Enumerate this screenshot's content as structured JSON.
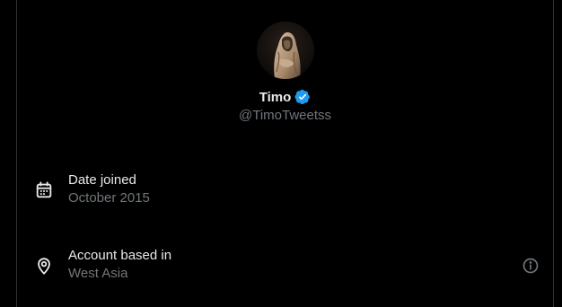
{
  "profile": {
    "display_name": "Timo",
    "handle": "@TimoTweetss",
    "verified": true,
    "verified_color": "#1d9bf0"
  },
  "details": {
    "date_joined": {
      "label": "Date joined",
      "value": "October 2015",
      "icon": "calendar-icon"
    },
    "location": {
      "label": "Account based in",
      "value": "West Asia",
      "icon": "location-pin-icon",
      "info_icon": "info-icon"
    }
  },
  "theme": {
    "background": "#000000",
    "text_primary": "#e7e9ea",
    "text_secondary": "#71767b",
    "border": "#2f3336"
  }
}
